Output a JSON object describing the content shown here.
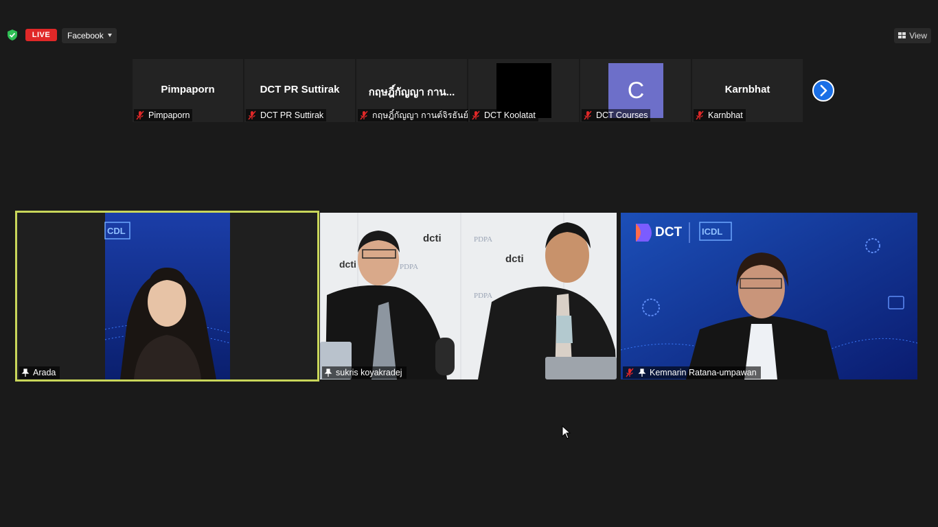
{
  "topbar": {
    "live_label": "LIVE",
    "stream_target": "Facebook",
    "view_label": "View"
  },
  "gallery_strip": {
    "thumbnails": [
      {
        "display": "Pimpaporn",
        "name": "Pimpaporn",
        "muted": true
      },
      {
        "display": "DCT PR Suttirak",
        "name": "DCT PR Suttirak",
        "muted": true
      },
      {
        "display": "กฤษฎิ์กัญญา กาน...",
        "name": "กฤษฎิ์กัญญา กานต์จิรธันย์",
        "muted": true
      },
      {
        "display": "",
        "name": "DCT Koolatat",
        "muted": true
      },
      {
        "display": "C",
        "name": "DCT Courses",
        "muted": true
      },
      {
        "display": "Karnbhat",
        "name": "Karnbhat",
        "muted": true
      }
    ]
  },
  "speakers": [
    {
      "name": "Arada",
      "pinned": true,
      "active": true
    },
    {
      "name": "sukris koyakradej",
      "pinned": true,
      "active": false
    },
    {
      "name": "Kemnarin Ratana-umpawan",
      "pinned": true,
      "muted": true,
      "active": false
    }
  ],
  "colors": {
    "live": "#e02828",
    "active_border": "#c9d65a",
    "next": "#1a6fe6",
    "avatar": "#6d6fc9"
  }
}
